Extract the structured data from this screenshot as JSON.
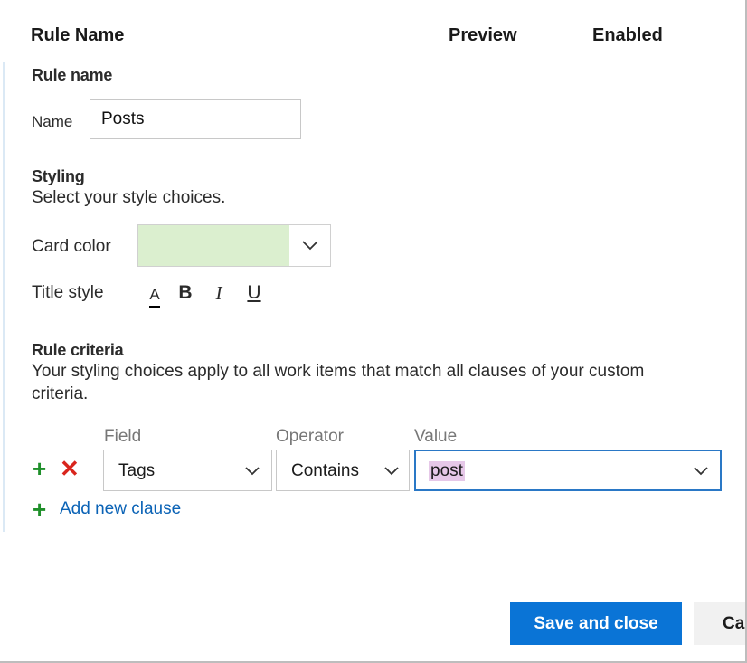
{
  "header": {
    "rule_name": "Rule Name",
    "preview": "Preview",
    "enabled": "Enabled"
  },
  "rule_name_section": {
    "title": "Rule name",
    "name_label": "Name",
    "name_value": "Posts"
  },
  "styling": {
    "title": "Styling",
    "description": "Select your style choices.",
    "card_color_label": "Card color",
    "card_color_value": "#dbefcf",
    "title_style_label": "Title style",
    "title_style_buttons": [
      "A",
      "B",
      "I",
      "U"
    ]
  },
  "criteria": {
    "title": "Rule criteria",
    "description_line1": "Your styling choices apply to all work items that match all clauses of your custom",
    "description_line2": "criteria.",
    "field_label": "Field",
    "operator_label": "Operator",
    "value_label": "Value",
    "clause": {
      "field": "Tags",
      "operator": "Contains",
      "value": "post"
    },
    "add_clause": "Add new clause"
  },
  "footer": {
    "save": "Save and close",
    "cancel": "Ca"
  },
  "colors": {
    "accent": "#0a74d6",
    "add": "#1f8f2a",
    "remove": "#d9251d",
    "link": "#0b63b6"
  }
}
